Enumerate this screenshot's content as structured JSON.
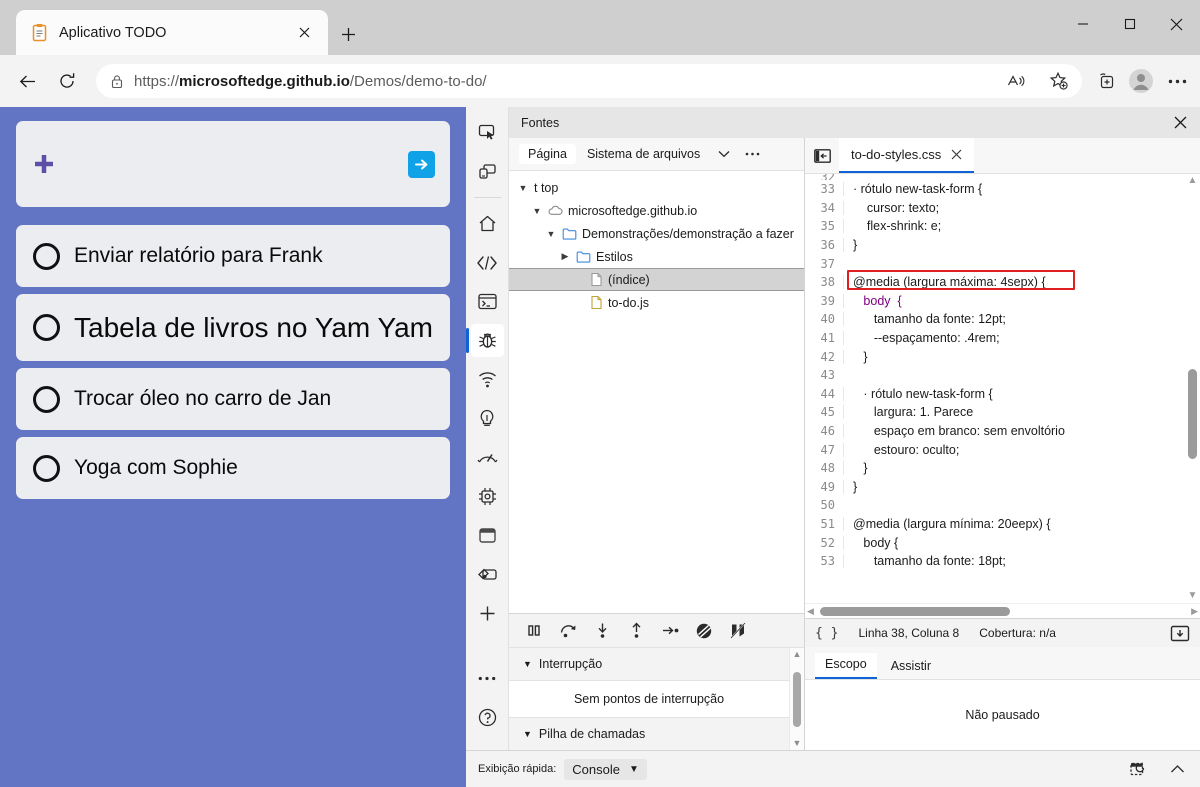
{
  "browser": {
    "tab": {
      "title": "Aplicativo TODO",
      "favicon": "clipboard-icon",
      "close": "×"
    },
    "new_tab_label": "+",
    "window_controls": {
      "minimize": "—",
      "maximize": "▢",
      "close": "✕"
    },
    "toolbar": {
      "back": "back-arrow-icon",
      "reload": "reload-icon",
      "lock": "lock-icon",
      "url_prefix": "https://",
      "url_domain": "microsoftedge.github.io",
      "url_path": "/Demos/demo-to-do/",
      "url_full": "https://microsoftedge.github.io/Demos/demo-to-do/",
      "read_aloud": "read-aloud-icon",
      "favorite": "add-favorite-icon",
      "collections": "collections-icon",
      "profile": "profile-avatar-icon",
      "settings": "ellipsis-icon"
    }
  },
  "todo_app": {
    "background_color": "#6274c4",
    "card_color": "#ecedf1",
    "add_icon": "plus-icon",
    "submit_icon": "arrow-right-icon",
    "submit_color": "#0fa2e7",
    "new_task_placeholder": "",
    "items": [
      {
        "label": "Enviar relatório para Frank",
        "big": false
      },
      {
        "label": "Tabela de livros no Yam Yam",
        "big": true
      },
      {
        "label": "Trocar óleo no carro de Jan",
        "big": false
      },
      {
        "label": "Yoga com Sophie",
        "big": false
      }
    ]
  },
  "devtools": {
    "header_title": "Fontes",
    "close_label": "✕",
    "activity_bar": [
      {
        "name": "inspect-element-icon",
        "selected": false
      },
      {
        "name": "device-emulation-icon",
        "selected": false
      },
      {
        "name": "welcome-home-icon",
        "selected": false
      },
      {
        "name": "elements-code-icon",
        "selected": false
      },
      {
        "name": "console-terminal-icon",
        "selected": false
      },
      {
        "name": "sources-debugger-icon",
        "selected": true
      },
      {
        "name": "network-icon",
        "selected": false
      },
      {
        "name": "issues-lightbulb-icon",
        "selected": false
      },
      {
        "name": "performance-icon",
        "selected": false
      },
      {
        "name": "memory-chip-icon",
        "selected": false
      },
      {
        "name": "application-storage-icon",
        "selected": false
      },
      {
        "name": "inspect-styles-icon",
        "selected": false
      },
      {
        "name": "more-tools-plus-icon",
        "selected": false
      },
      {
        "name": "more-options-ellipsis-icon",
        "selected": false
      },
      {
        "name": "help-question-icon",
        "selected": false
      }
    ],
    "navigator": {
      "tabs": [
        {
          "label": "Página",
          "active": true
        },
        {
          "label": "Sistema de arquivos",
          "active": false
        }
      ],
      "more_tabs_icon": "chevron-down-icon",
      "more_options_icon": "ellipsis-icon",
      "tree": [
        {
          "label": "t top",
          "depth": 0,
          "caret": "▼",
          "icon": "none",
          "selected": false
        },
        {
          "label": "microsoftedge.github.io",
          "depth": 1,
          "caret": "▼",
          "icon": "cloud-icon",
          "selected": false
        },
        {
          "label": "Demonstrações/demonstração a fazer",
          "depth": 2,
          "caret": "▼",
          "icon": "folder-icon",
          "selected": false
        },
        {
          "label": "Estilos",
          "depth": 3,
          "caret": "▶",
          "icon": "folder-icon",
          "selected": false
        },
        {
          "label": "(índice)",
          "depth": 4,
          "caret": "",
          "icon": "file-icon",
          "selected": true
        },
        {
          "label": "to-do.js",
          "depth": 4,
          "caret": "",
          "icon": "file-js-icon",
          "selected": false
        }
      ]
    },
    "debugger": {
      "toolbar": [
        "pause-resume-icon",
        "step-over-icon",
        "step-into-icon",
        "step-out-icon",
        "step-icon",
        "deactivate-breakpoints-icon",
        "pause-on-exceptions-icon"
      ],
      "sections": [
        {
          "caret": "▼",
          "label": "Interrupção"
        },
        {
          "caret": "▼",
          "label": "Pilha de chamadas"
        }
      ],
      "empty_text": "Sem pontos de interrupção"
    },
    "editor": {
      "back_icon": "show-navigator-icon",
      "tab_name": "to-do-styles.css",
      "tab_close": "✕",
      "first_line_number": 33,
      "lines": [
        {
          "n": 33,
          "text": "· rótulo new-task-form {"
        },
        {
          "n": 34,
          "text": "    cursor: texto;"
        },
        {
          "n": 35,
          "text": "    flex-shrink: e;"
        },
        {
          "n": 36,
          "text": "}"
        },
        {
          "n": 37,
          "text": ""
        },
        {
          "n": 38,
          "text": "@media (largura máxima: 4sepx) {",
          "highlighted": true
        },
        {
          "n": 39,
          "text": "   body  {"
        },
        {
          "n": 40,
          "text": "      tamanho da fonte: 12pt;"
        },
        {
          "n": 41,
          "text": "      --espaçamento: .4rem;"
        },
        {
          "n": 42,
          "text": "   }"
        },
        {
          "n": 43,
          "text": ""
        },
        {
          "n": 44,
          "text": "   · rótulo new-task-form {"
        },
        {
          "n": 45,
          "text": "      largura: 1. Parece"
        },
        {
          "n": 46,
          "text": "      espaço em branco: sem envoltório"
        },
        {
          "n": 47,
          "text": "      estouro: oculto;"
        },
        {
          "n": 48,
          "text": "   }"
        },
        {
          "n": 49,
          "text": "}"
        },
        {
          "n": 50,
          "text": ""
        },
        {
          "n": 51,
          "text": "@media (largura mínima: 20eepx) {"
        },
        {
          "n": 52,
          "text": "   body {"
        },
        {
          "n": 53,
          "text": "      tamanho da fonte: 18pt;"
        }
      ],
      "status": {
        "format_icon": "{ }",
        "position": "Linha 38, Coluna 8",
        "coverage": "Cobertura: n/a",
        "pretty_print_icon": "pretty-print-icon"
      }
    },
    "scope": {
      "tabs": [
        {
          "label": "Escopo",
          "active": true
        },
        {
          "label": "Assistir",
          "active": false
        }
      ],
      "empty_text": "Não pausado"
    },
    "footer": {
      "quick_view_label": "Exibição rápida:",
      "quick_view_value": "Console",
      "quick_view_caret": "▼",
      "toggle_drawer_icon": "restore-drawer-icon",
      "collapse_icon": "chevron-up-icon"
    }
  }
}
